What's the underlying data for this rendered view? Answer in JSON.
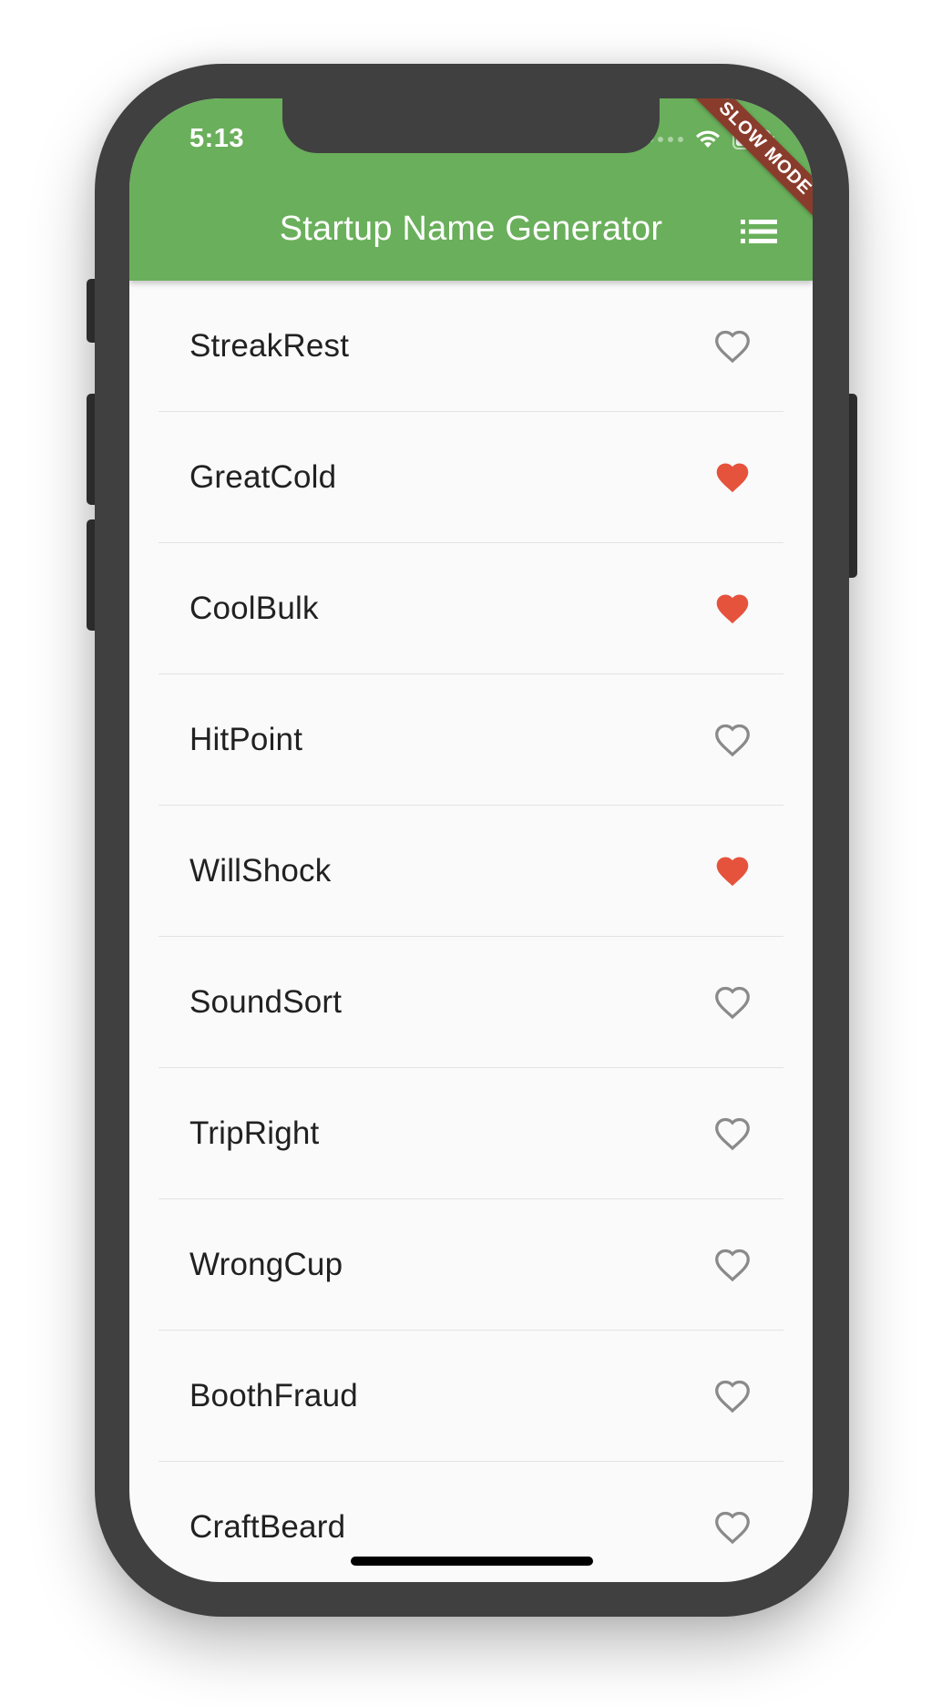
{
  "status_bar": {
    "time": "5:13"
  },
  "app_bar": {
    "title": "Startup Name Generator",
    "action_icon": "list-icon"
  },
  "debug_banner": {
    "label": "SLOW MODE"
  },
  "colors": {
    "app_bar": "#6aaf5b",
    "favorite": "#e5533d",
    "not_favorite": "#8a8a8a"
  },
  "names": [
    {
      "name": "StreakRest",
      "favorite": false
    },
    {
      "name": "GreatCold",
      "favorite": true
    },
    {
      "name": "CoolBulk",
      "favorite": true
    },
    {
      "name": "HitPoint",
      "favorite": false
    },
    {
      "name": "WillShock",
      "favorite": true
    },
    {
      "name": "SoundSort",
      "favorite": false
    },
    {
      "name": "TripRight",
      "favorite": false
    },
    {
      "name": "WrongCup",
      "favorite": false
    },
    {
      "name": "BoothFraud",
      "favorite": false
    },
    {
      "name": "CraftBeard",
      "favorite": false
    }
  ]
}
